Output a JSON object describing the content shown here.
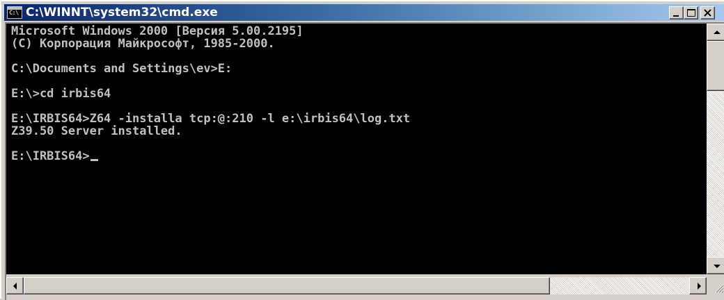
{
  "window": {
    "title": "C:\\WINNT\\system32\\cmd.exe",
    "icon": "console-icon",
    "icon_glyph": "C:\\"
  },
  "console": {
    "lines": [
      "Microsoft Windows 2000 [Версия 5.00.2195]",
      "(C) Корпорация Майкрософт, 1985-2000.",
      "",
      "C:\\Documents and Settings\\ev>E:",
      "",
      "E:\\>cd irbis64",
      "",
      "E:\\IRBIS64>Z64 -installa tcp:@:210 -l e:\\irbis64\\log.txt",
      "Z39.50 Server installed.",
      "",
      "E:\\IRBIS64>"
    ],
    "text_color": "#c0c0c0",
    "background": "#000000"
  },
  "controls": {
    "minimize_icon": "minimize-icon",
    "maximize_icon": "maximize-icon",
    "close_icon": "close-icon"
  }
}
